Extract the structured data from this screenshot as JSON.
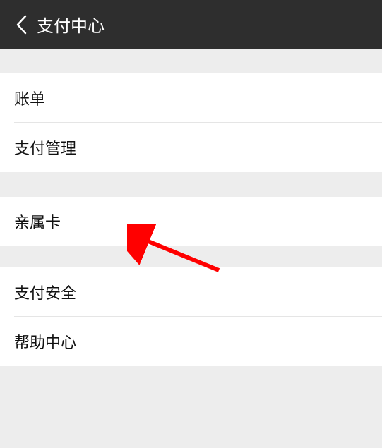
{
  "header": {
    "title": "支付中心"
  },
  "sections": [
    {
      "items": [
        {
          "label": "账单"
        },
        {
          "label": "支付管理"
        }
      ]
    },
    {
      "items": [
        {
          "label": "亲属卡"
        }
      ]
    },
    {
      "items": [
        {
          "label": "支付安全"
        },
        {
          "label": "帮助中心"
        }
      ]
    }
  ]
}
